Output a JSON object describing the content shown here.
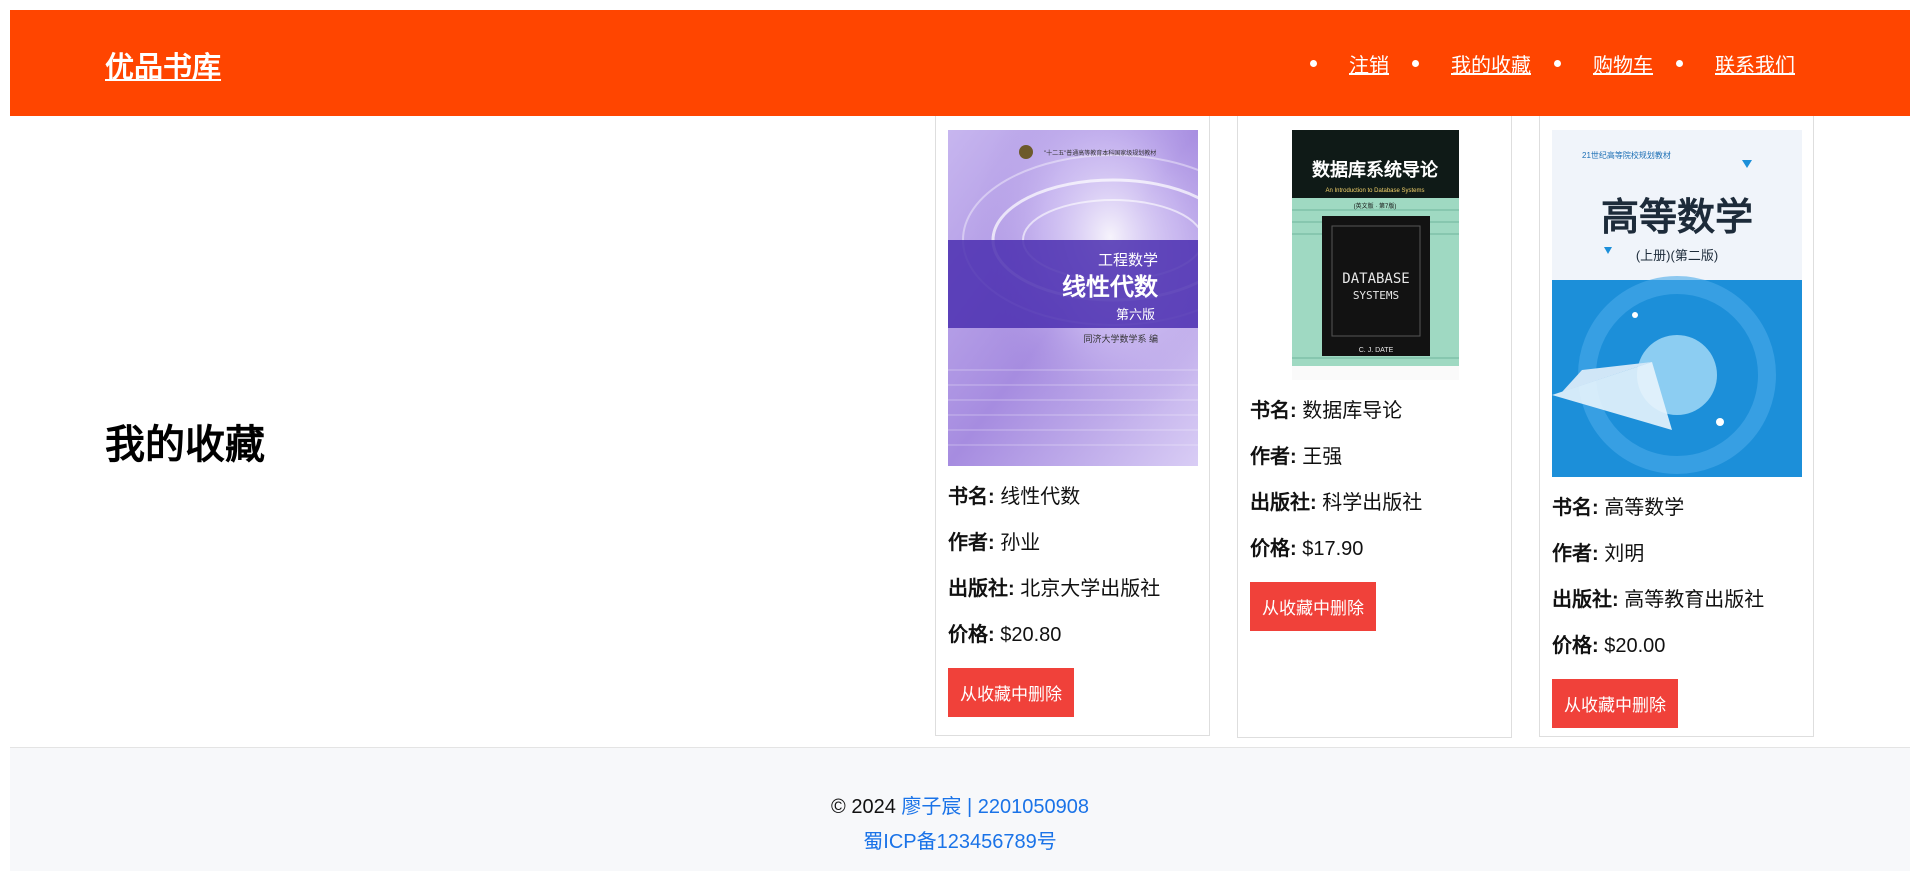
{
  "header": {
    "brand": "优品书库",
    "nav": [
      {
        "label": "注销"
      },
      {
        "label": "我的收藏"
      },
      {
        "label": "购物车"
      },
      {
        "label": "联系我们"
      }
    ],
    "background": "#ff4500"
  },
  "main": {
    "title": "我的收藏"
  },
  "labels": {
    "name": "书名:",
    "author": "作者:",
    "publisher": "出版社:",
    "price": "价格:",
    "remove": "从收藏中删除"
  },
  "books": [
    {
      "name": "线性代数",
      "author": "孙业",
      "publisher": "北京大学出版社",
      "price": "$20.80",
      "cover": {
        "top_text": "\"十二五\"普通高等教育本科国家级规划教材",
        "series": "工程数学",
        "title": "线性代数",
        "edition": "第六版",
        "editor": "同济大学数学系 编"
      }
    },
    {
      "name": "数据库导论",
      "author": "王强",
      "publisher": "科学出版社",
      "price": "$17.90",
      "cover": {
        "title": "数据库系统导论",
        "subtitle": "An Introduction to Database Systems",
        "edition": "(英文版 · 第7版)",
        "big1": "DATABASE",
        "big2": "SYSTEMS",
        "author": "C. J. DATE"
      }
    },
    {
      "name": "高等数学",
      "author": "刘明",
      "publisher": "高等教育出版社",
      "price": "$20.00",
      "cover": {
        "top_text": "21世纪高等院校规划教材",
        "title": "高等数学",
        "edition": "(上册)(第二版)"
      }
    }
  ],
  "footer": {
    "copyright": "© 2024",
    "author_link": "廖子宸 | 2201050908",
    "icp": "蜀ICP备123456789号"
  }
}
